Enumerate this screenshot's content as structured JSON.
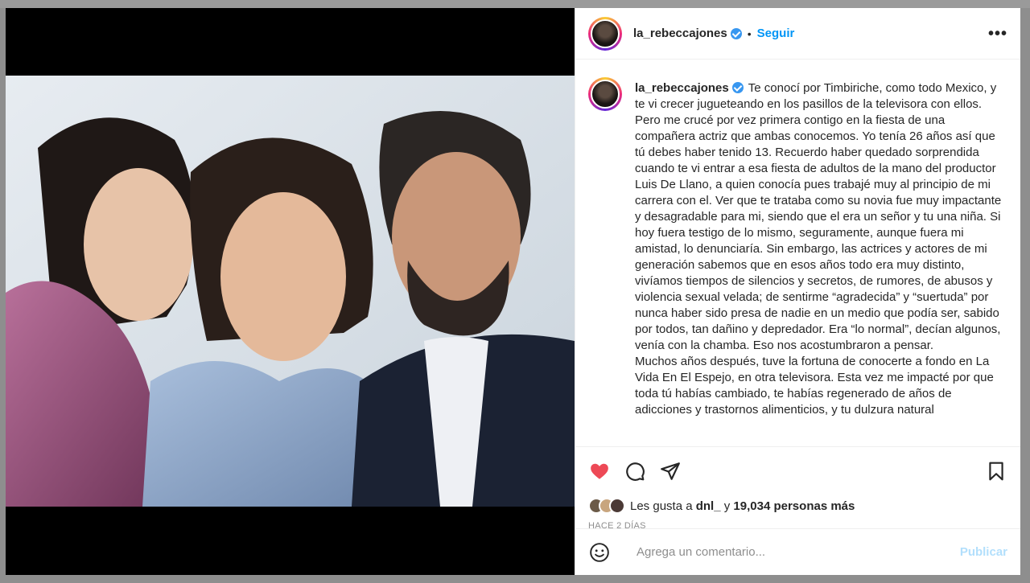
{
  "post": {
    "username": "la_rebeccajones",
    "follow_label": "Seguir",
    "separator": "•",
    "more_label": "•••",
    "caption": "Te conocí por Timbiriche, como todo Mexico, y te vi crecer jugueteando en los pasillos de la televisora con ellos. Pero me crucé por vez primera contigo en la fiesta de una compañera actriz que ambas conocemos. Yo tenía 26 años así que tú debes haber tenido 13. Recuerdo haber quedado sorprendida cuando te vi entrar a esa fiesta de adultos de la mano del productor Luis De Llano, a quien conocía pues trabajé muy al principio de mi carrera con el. Ver que te trataba como su novia fue muy impactante y desagradable para mi, siendo que el era un señor y tu una niña. Si hoy fuera testigo de lo mismo, seguramente, aunque fuera mi amistad, lo denunciaría. Sin embargo, las actrices y actores de mi generación sabemos que en esos años todo era muy distinto, vivíamos tiempos de silencios y secretos, de rumores, de abusos y violencia sexual velada; de sentirme “agradecida” y “suertuda” por nunca haber sido presa de nadie en un medio que podía ser, sabido por todos, tan dañino y depredador. Era “lo normal”, decían algunos, venía con la chamba. Eso nos acostumbraron a pensar.",
    "caption_2": "Muchos años después, tuve la fortuna de conocerte a fondo en La Vida En El Espejo, en otra televisora. Esta vez me impacté por que toda tú habías cambiado, te habías regenerado de años de adicciones y trastornos alimenticios, y tu dulzura natural"
  },
  "likes": {
    "prefix": "Les gusta a",
    "first_user": "dnl_",
    "connector": "y",
    "others": "19,034 personas más"
  },
  "timestamp": "HACE 2 DÍAS",
  "comment": {
    "placeholder": "Agrega un comentario...",
    "publish_label": "Publicar"
  },
  "colors": {
    "like_red": "#ed4956",
    "follow_blue": "#0095f6",
    "verified_blue": "#3897f0",
    "publish_disabled": "#b2dffc"
  }
}
